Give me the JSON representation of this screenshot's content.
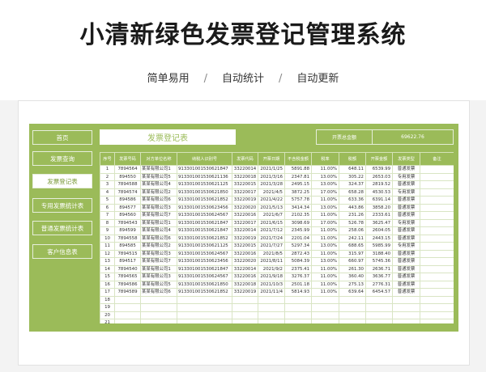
{
  "banner": {
    "title": "小清新绿色发票登记管理系统",
    "features": [
      "简单易用",
      "自动统计",
      "自动更新"
    ],
    "separator": "/"
  },
  "nav": {
    "items": [
      {
        "label": "首页",
        "active": false
      },
      {
        "label": "发票查询",
        "active": false
      },
      {
        "label": "发票登记表",
        "active": true
      },
      {
        "label": "专用发票统计表",
        "active": false
      },
      {
        "label": "普通发票统计表",
        "active": false
      },
      {
        "label": "客户信息表",
        "active": false
      }
    ]
  },
  "form": {
    "title": "发票登记表",
    "total_label": "开票总金额",
    "total_value": "69622.76"
  },
  "colors": {
    "accent": "#9bbb59",
    "panel": "#9bbb59"
  },
  "table": {
    "headers": [
      "序号",
      "发票号码",
      "对方单位名称",
      "纳税人识别号",
      "发票代码",
      "开票日期",
      "不含税金额",
      "税率",
      "税额",
      "开票金额",
      "发票类型",
      "备注"
    ],
    "rows": [
      [
        "1",
        "7894564",
        "某某有限公司1",
        "913301001530621847",
        "33220014",
        "2021/1/25",
        "5891.88",
        "11.00%",
        "648.11",
        "6539.99",
        "普通发票",
        ""
      ],
      [
        "2",
        "894550",
        "某某有限公司5",
        "913301001530621136",
        "33220018",
        "2021/3/16",
        "2347.81",
        "13.00%",
        "305.22",
        "2653.03",
        "专用发票",
        ""
      ],
      [
        "3",
        "7894588",
        "某某有限公司4",
        "913301001530621125",
        "33220015",
        "2021/3/28",
        "2495.15",
        "13.00%",
        "324.37",
        "2819.52",
        "普通发票",
        ""
      ],
      [
        "4",
        "7894574",
        "某某有限公司2",
        "913301001530621850",
        "33220017",
        "2021/4/5",
        "3872.25",
        "17.00%",
        "658.28",
        "4530.53",
        "专用发票",
        ""
      ],
      [
        "5",
        "894586",
        "某某有限公司6",
        "913301001530621852",
        "33220019",
        "2021/4/22",
        "5757.78",
        "11.00%",
        "633.36",
        "6391.14",
        "普通发票",
        ""
      ],
      [
        "6",
        "894577",
        "某某有限公司3",
        "913301001530623456",
        "33220020",
        "2021/5/13",
        "3414.34",
        "13.00%",
        "443.86",
        "3858.20",
        "普通发票",
        ""
      ],
      [
        "7",
        "894560",
        "某某有限公司7",
        "913301001530624567",
        "33220016",
        "2021/6/7",
        "2102.35",
        "11.00%",
        "231.26",
        "2333.61",
        "普通发票",
        ""
      ],
      [
        "8",
        "7894543",
        "某某有限公司1",
        "913301001530621847",
        "33220017",
        "2021/6/15",
        "3098.69",
        "17.00%",
        "526.78",
        "3625.47",
        "专用发票",
        ""
      ],
      [
        "9",
        "894599",
        "某某有限公司4",
        "913301001530621847",
        "33220014",
        "2021/7/12",
        "2345.99",
        "11.00%",
        "258.06",
        "2604.05",
        "普通发票",
        ""
      ],
      [
        "10",
        "7894558",
        "某某有限公司6",
        "913301001530621852",
        "33220019",
        "2021/7/24",
        "2201.04",
        "11.00%",
        "242.11",
        "2443.15",
        "普通发票",
        ""
      ],
      [
        "11",
        "894585",
        "某某有限公司2",
        "913301001530621125",
        "33220015",
        "2021/7/27",
        "5297.34",
        "13.00%",
        "688.65",
        "5985.99",
        "专用发票",
        ""
      ],
      [
        "12",
        "7894515",
        "某某有限公司3",
        "913301001530624567",
        "33220016",
        "2021/8/5",
        "2872.43",
        "11.00%",
        "315.97",
        "3188.40",
        "普通发票",
        ""
      ],
      [
        "13",
        "894517",
        "某某有限公司7",
        "913301001530623456",
        "33220020",
        "2021/8/11",
        "5084.39",
        "13.00%",
        "660.97",
        "5745.36",
        "普通发票",
        ""
      ],
      [
        "14",
        "7894540",
        "某某有限公司1",
        "913301001530621847",
        "33220014",
        "2021/9/2",
        "2375.41",
        "11.00%",
        "261.30",
        "2636.71",
        "普通发票",
        ""
      ],
      [
        "15",
        "7894565",
        "某某有限公司3",
        "913301001530624567",
        "33220016",
        "2021/9/18",
        "3276.37",
        "11.00%",
        "360.40",
        "3636.77",
        "普通发票",
        ""
      ],
      [
        "16",
        "7894586",
        "某某有限公司5",
        "913301001530621850",
        "33220018",
        "2021/10/3",
        "2501.18",
        "11.00%",
        "275.13",
        "2776.31",
        "普通发票",
        ""
      ],
      [
        "17",
        "7894589",
        "某某有限公司6",
        "913301001530621852",
        "33220019",
        "2021/11/4",
        "5814.93",
        "11.00%",
        "639.64",
        "6454.57",
        "普通发票",
        ""
      ],
      [
        "18",
        "",
        "",
        "",
        "",
        "",
        "",
        "",
        "",
        "",
        "",
        ""
      ],
      [
        "19",
        "",
        "",
        "",
        "",
        "",
        "",
        "",
        "",
        "",
        "",
        ""
      ],
      [
        "20",
        "",
        "",
        "",
        "",
        "",
        "",
        "",
        "",
        "",
        "",
        ""
      ],
      [
        "21",
        "",
        "",
        "",
        "",
        "",
        "",
        "",
        "",
        "",
        "",
        ""
      ],
      [
        "22",
        "",
        "",
        "",
        "",
        "",
        "",
        "",
        "",
        "",
        "",
        ""
      ]
    ]
  }
}
